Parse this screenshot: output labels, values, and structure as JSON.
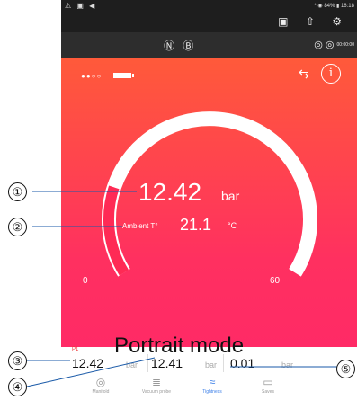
{
  "statusbar": {
    "left_icons": "⚠ ▣ ◀",
    "right_text": "* ◉ 84% ▮ 16:18"
  },
  "appbar": {
    "icons": "▣ ⇧ ⚙"
  },
  "modebar": {
    "center_icons": "Ⓝ Ⓑ",
    "right_icons": "◎ ◎",
    "timer": "00:00:00"
  },
  "status": {
    "dots": "●●○○",
    "swap_icon": "⇆"
  },
  "gauge": {
    "value": "12.42",
    "unit": "bar",
    "ambient_label": "Ambient T°",
    "ambient_value": "21.1",
    "ambient_unit": "°C",
    "min": "0",
    "max": "60",
    "fraction": 0.207
  },
  "readings": {
    "label": "P1",
    "items": [
      {
        "value": "12.42",
        "unit": "bar"
      },
      {
        "value": "12.41",
        "unit": "bar"
      },
      {
        "value": "0.01",
        "unit": "bar"
      }
    ]
  },
  "nav": [
    {
      "label": "Manifold",
      "icon": "◎"
    },
    {
      "label": "Vacuum probe",
      "icon": "≣"
    },
    {
      "label": "Tightness",
      "icon": "≈"
    },
    {
      "label": "Saves",
      "icon": "▭"
    }
  ],
  "active_nav": 2,
  "caption": "Portrait mode",
  "callouts": [
    "①",
    "②",
    "③",
    "④",
    "⑤"
  ],
  "colors": {
    "gradient_top": "#ff5a3a",
    "gradient_bottom": "#ff2a66",
    "active": "#3a7ee8"
  }
}
